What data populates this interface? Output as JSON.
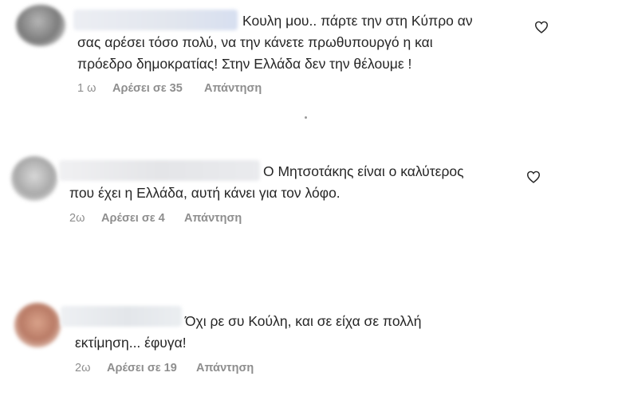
{
  "comments": [
    {
      "text_lines": [
        "Κουλη μου.. πάρτε την στη Κύπρο αν",
        "σας αρέσει τόσο πολύ, να την κάνετε πρωθυπουργό η και",
        "πρόεδρο δημοκρατίας! Στην Ελλάδα δεν την θέλουμε !"
      ],
      "time": "1 ω",
      "likes": "Αρέσει σε 35",
      "reply": "Απάντηση",
      "like_icon": "heart-outline-icon"
    },
    {
      "text_lines": [
        "Ο Μητσοτάκης είναι ο καλύτερος",
        "που έχει η Ελλάδα, αυτή κάνει για τον λόφο."
      ],
      "time": "2ω",
      "likes": "Αρέσει σε 4",
      "reply": "Απάντηση",
      "like_icon": "heart-outline-icon"
    },
    {
      "text_lines": [
        "Όχι ρε συ Κούλη, και σε είχα σε πολλή",
        "εκτίμηση... έφυγα!"
      ],
      "time": "2ω",
      "likes": "Αρέσει σε 19",
      "reply": "Απάντηση"
    }
  ]
}
